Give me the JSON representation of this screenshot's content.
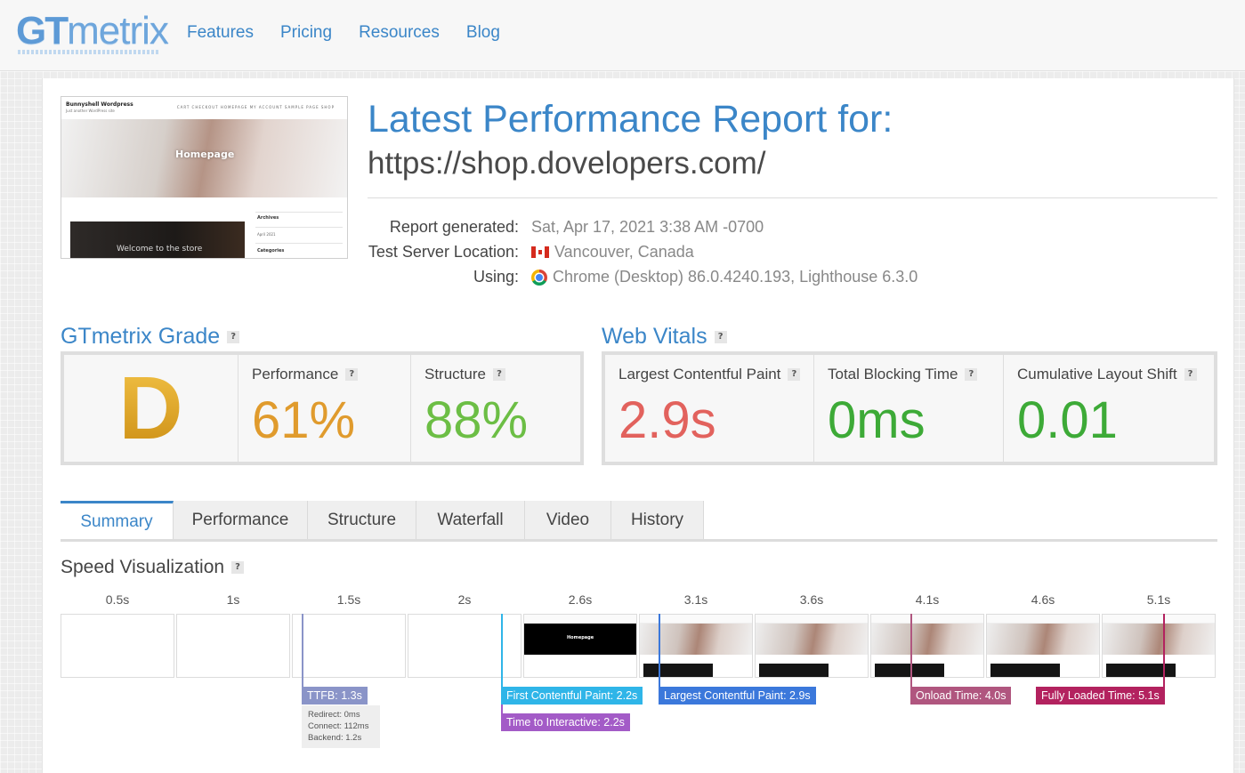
{
  "header": {
    "logo": {
      "part1": "GT",
      "part2": "metrix"
    },
    "nav": [
      "Features",
      "Pricing",
      "Resources",
      "Blog"
    ]
  },
  "thumbnail": {
    "site_title": "Bunnyshell Wordpress",
    "site_subtitle": "Just another WordPress site",
    "site_nav": "CART   CHECKOUT   HOMEPAGE   MY ACCOUNT   SAMPLE PAGE   SHOP",
    "hero_text": "Homepage",
    "welcome_text": "Welcome to the store",
    "sidebar": [
      "Archives",
      "April 2021",
      "Categories"
    ]
  },
  "report": {
    "heading": "Latest Performance Report for:",
    "url": "https://shop.dovelopers.com/",
    "meta": [
      {
        "label": "Report generated:",
        "value": "Sat, Apr 17, 2021 3:38 AM -0700",
        "icon": ""
      },
      {
        "label": "Test Server Location:",
        "value": "Vancouver, Canada",
        "icon": "canada-flag-icon"
      },
      {
        "label": "Using:",
        "value": "Chrome (Desktop) 86.0.4240.193, Lighthouse 6.3.0",
        "icon": "chrome-icon"
      }
    ]
  },
  "grade": {
    "title": "GTmetrix Grade",
    "letter": "D",
    "performance_label": "Performance",
    "performance_value": "61%",
    "structure_label": "Structure",
    "structure_value": "88%",
    "colors": {
      "performance": "#e09b2d",
      "structure": "#6cbe45",
      "grade": "#e2a520"
    }
  },
  "web_vitals": {
    "title": "Web Vitals",
    "lcp_label": "Largest Contentful Paint",
    "lcp_value": "2.9s",
    "tbt_label": "Total Blocking Time",
    "tbt_value": "0ms",
    "cls_label": "Cumulative Layout Shift",
    "cls_value": "0.01",
    "colors": {
      "lcp": "#e2625d",
      "tbt": "#3daa37",
      "cls": "#3daa37"
    }
  },
  "tabs": [
    "Summary",
    "Performance",
    "Structure",
    "Waterfall",
    "Video",
    "History"
  ],
  "speed": {
    "title": "Speed Visualization",
    "ticks": [
      "0.5s",
      "1s",
      "1.5s",
      "2s",
      "2.6s",
      "3.1s",
      "3.6s",
      "4.1s",
      "4.6s",
      "5.1s"
    ],
    "markers": [
      {
        "label": "TTFB: 1.3s",
        "color": "#8a94c8"
      },
      {
        "label": "First Contentful Paint: 2.2s",
        "color": "#2fb5e8"
      },
      {
        "label": "Time to Interactive: 2.2s",
        "color": "#a35bc7"
      },
      {
        "label": "Largest Contentful Paint: 2.9s",
        "color": "#3b78db"
      },
      {
        "label": "Onload Time: 4.0s",
        "color": "#b0567f"
      },
      {
        "label": "Fully Loaded Time: 5.1s",
        "color": "#b3225f"
      }
    ],
    "ttfb_details": [
      "Redirect: 0ms",
      "Connect: 112ms",
      "Backend: 1.2s"
    ]
  }
}
